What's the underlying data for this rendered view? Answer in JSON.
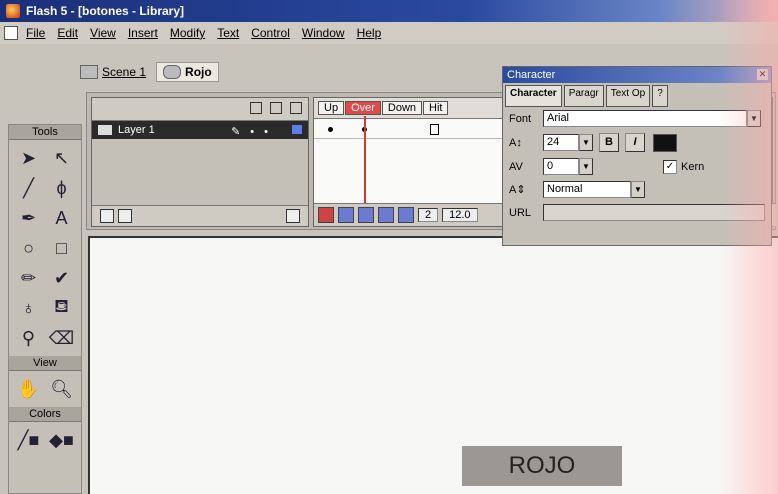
{
  "window": {
    "title": "Flash 5 - [botones - Library]"
  },
  "menu": [
    "File",
    "Edit",
    "View",
    "Insert",
    "Modify",
    "Text",
    "Control",
    "Window",
    "Help"
  ],
  "scenebar": {
    "scene": "Scene 1",
    "symbol": "Rojo"
  },
  "timeline": {
    "layer_name": "Layer 1",
    "frame_labels": [
      "Up",
      "Over",
      "Down",
      "Hit"
    ],
    "current_frame": "2",
    "frame_rate": "12.0"
  },
  "tools": {
    "title": "Tools",
    "view": "View",
    "colors": "Colors"
  },
  "character_panel": {
    "title": "Character",
    "tabs": [
      "Character",
      "Paragr",
      "Text Op"
    ],
    "font_label": "Font",
    "font_value": "Arial",
    "size_value": "24",
    "bold": "B",
    "italic": "I",
    "tracking_value": "0",
    "kern_label": "Kern",
    "baseline_value": "Normal",
    "url_label": "URL"
  },
  "stage": {
    "button_text": "ROJO"
  }
}
